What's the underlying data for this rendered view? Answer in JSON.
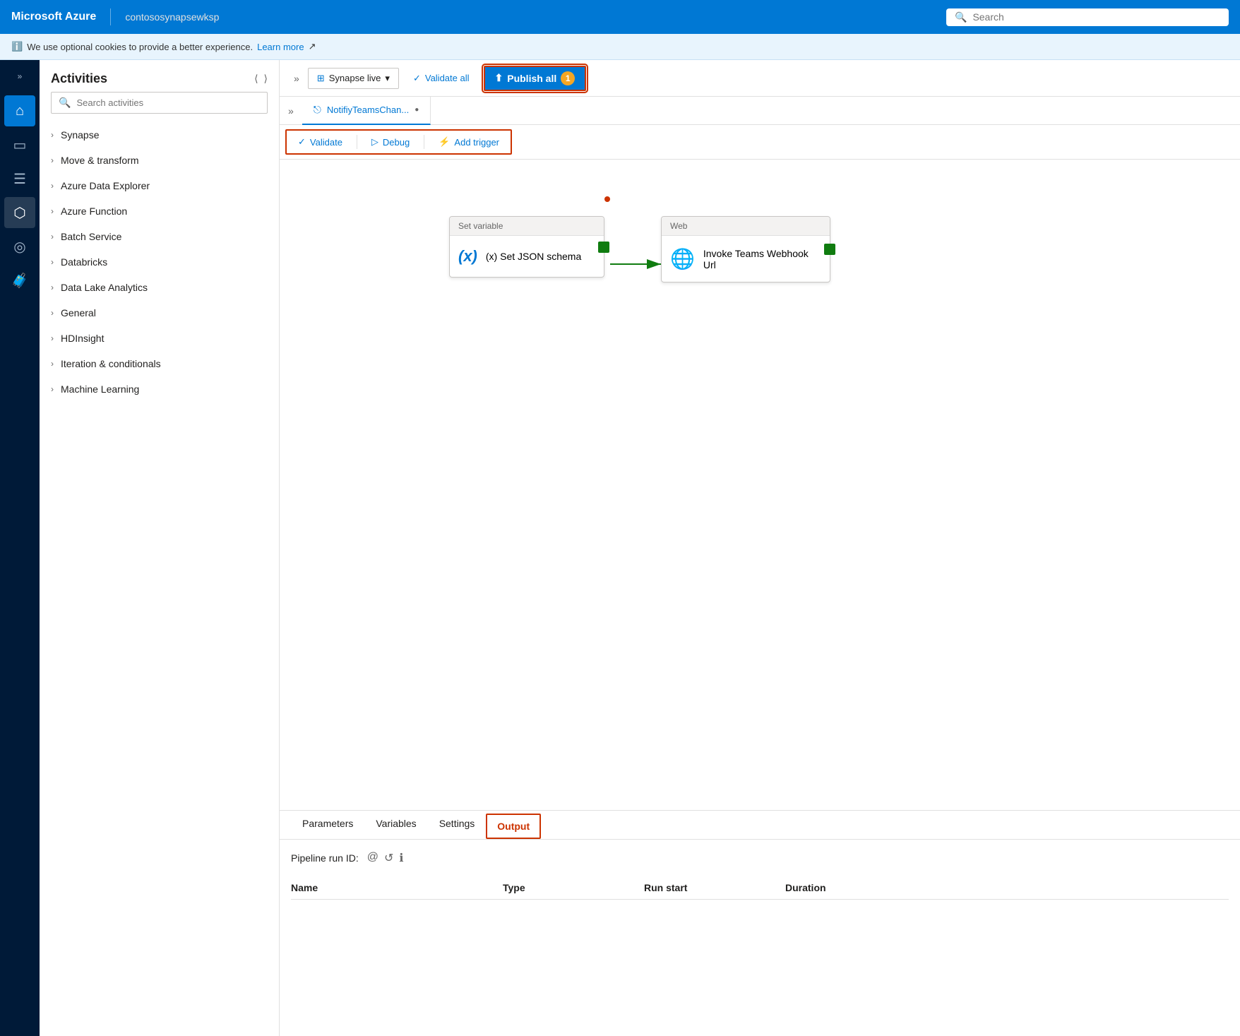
{
  "topBar": {
    "brand": "Microsoft Azure",
    "workspace": "contososynapsewksp",
    "search_placeholder": "Search"
  },
  "cookieBar": {
    "text": "We use optional cookies to provide a better experience.",
    "link": "Learn more",
    "icon": "ℹ"
  },
  "toolbar": {
    "chevron": "»",
    "synapse_live": "Synapse live",
    "validate_all": "Validate all",
    "publish_all": "Publish all",
    "publish_count": "1"
  },
  "tab": {
    "expand": "»",
    "label": "NotifiyTeamsChan...",
    "dot": "●"
  },
  "canvasActions": {
    "validate": "Validate",
    "debug": "Debug",
    "add_trigger": "Add trigger"
  },
  "nodes": {
    "set_variable": {
      "header": "Set variable",
      "label": "(x)  Set JSON schema"
    },
    "web": {
      "header": "Web",
      "label": "Invoke Teams Webhook Url"
    }
  },
  "activities": {
    "title": "Activities",
    "search_placeholder": "Search activities",
    "items": [
      "Synapse",
      "Move & transform",
      "Azure Data Explorer",
      "Azure Function",
      "Batch Service",
      "Databricks",
      "Data Lake Analytics",
      "General",
      "HDInsight",
      "Iteration & conditionals",
      "Machine Learning"
    ]
  },
  "bottomPanel": {
    "tabs": [
      "Parameters",
      "Variables",
      "Settings",
      "Output"
    ],
    "active_tab": "Output",
    "pipeline_run_id_label": "Pipeline run ID:",
    "table_headers": [
      "Name",
      "Type",
      "Run start",
      "Duration"
    ]
  },
  "navIcons": [
    {
      "name": "home-icon",
      "symbol": "⌂",
      "active": true
    },
    {
      "name": "database-icon",
      "symbol": "🗄"
    },
    {
      "name": "document-icon",
      "symbol": "📄"
    },
    {
      "name": "integration-icon",
      "symbol": "⟳"
    },
    {
      "name": "monitor-icon",
      "symbol": "◎"
    },
    {
      "name": "briefcase-icon",
      "symbol": "🧳"
    }
  ]
}
